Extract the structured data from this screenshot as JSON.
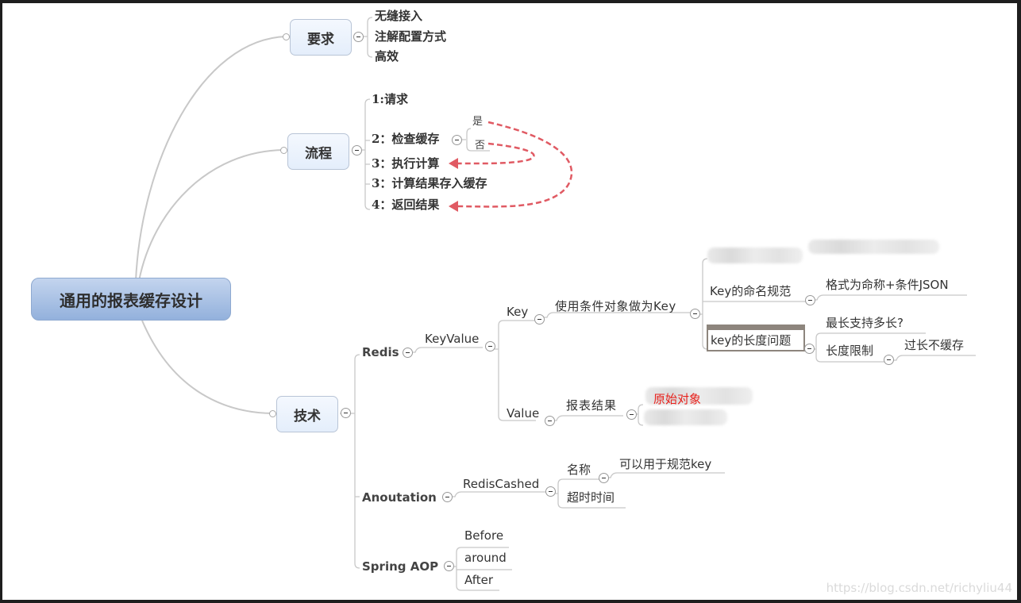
{
  "central": {
    "label": "通用的报表缓存设计"
  },
  "requirements": {
    "label": "要求",
    "items": [
      "无缝接入",
      "注解配置方式",
      "高效"
    ]
  },
  "process": {
    "label": "流程",
    "steps": [
      "1:请求",
      "2：检查缓存",
      "3：执行计算",
      "3：计算结果存入缓存",
      "4：返回结果"
    ],
    "branches": [
      "是",
      "否"
    ],
    "relationships": [
      {
        "from": "是",
        "to": "4：返回结果",
        "color": "#e05a63"
      },
      {
        "from": "否",
        "to": "3：执行计算",
        "color": "#e05a63"
      }
    ]
  },
  "tech": {
    "label": "技术",
    "redis": {
      "label": "Redis",
      "keyvalue": "KeyValue",
      "key": {
        "label": "Key",
        "usage": "使用条件对象做为Key",
        "children": {
          "blurred_top": "通用的条件字...",
          "naming": {
            "label": "Key的命名规范",
            "rule": "格式为命称+条件JSON"
          },
          "length": {
            "label": "key的长度问题",
            "question": "最长支持多长?",
            "limit": "长度限制",
            "limit_rule": "过长不缓存"
          }
        }
      },
      "value": {
        "label": "Value",
        "result": "报表结果",
        "children": [
          "原始对象",
          "..."
        ]
      }
    },
    "annotation": {
      "label": "Anoutation",
      "name": "RedisCashed",
      "attrs": [
        {
          "label": "名称",
          "note": "可以用于规范key"
        },
        {
          "label": "超时时间"
        }
      ]
    },
    "aop": {
      "label": "Spring AOP",
      "items": [
        "Before",
        "around",
        "After"
      ]
    }
  },
  "watermark": "https://blog.csdn.net/richyliu44",
  "colors": {
    "relationship": "#e05a63",
    "central_fill": "#9fb9e0",
    "topic_fill": "#e8f0fc",
    "line": "#c8c8c8"
  }
}
